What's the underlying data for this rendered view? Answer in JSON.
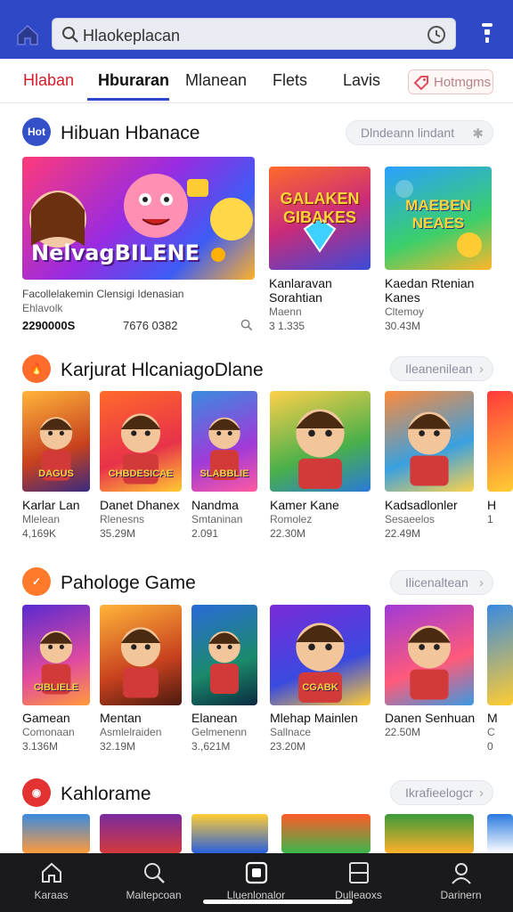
{
  "colors": {
    "brand_blue": "#2f48c8",
    "red_tab": "#d21e2a",
    "nav_bg": "#1a1a1c"
  },
  "search": {
    "text": "Hlaokeplacan",
    "left_icon": "search-icon",
    "right_icon": "clock-icon"
  },
  "tabs": [
    {
      "label": "Hlaban"
    },
    {
      "label": "Hburaran"
    },
    {
      "label": "Mlanean"
    },
    {
      "label": "Flets"
    },
    {
      "label": "Lavis"
    },
    {
      "label": "Hotmgms"
    }
  ],
  "section1": {
    "badge": "Hot",
    "title": "Hibuan Hbanace",
    "pill": "Dlndeann lindant",
    "featured": {
      "art_text": "NelvagBILENE",
      "caption": "Facollelakemin Clensigi Idenasian",
      "sub": "Ehlavolk",
      "stat1": "2290000S",
      "stat2": "7676 0382",
      "search_icon": "search-icon"
    },
    "cards": [
      {
        "art_text": "GALAKEN GIBAKES",
        "title": "Kanlaravan Sorahtian",
        "sub": "Maenn",
        "num": "3 1.335"
      },
      {
        "art_text": "MAEBEN NEAES",
        "title": "Kaedan Rtenian Kanes",
        "sub": "Cltemoy",
        "num": "30.43M"
      }
    ]
  },
  "section2": {
    "title": "Karjurat HlcaniagoDlane",
    "pill": "Ileanenilean",
    "cards": [
      {
        "art_text": "DAGUS",
        "title": "Karlar Lan",
        "sub": "Mlelean",
        "num": "4,169K"
      },
      {
        "art_text": "CHBDESICAE",
        "title": "Danet Dhanex",
        "sub": "Rlenesns",
        "num": "35.29M"
      },
      {
        "art_text": "SLABBLIE",
        "title": "Nandma",
        "sub": "Smtaninan",
        "num": "2.091"
      },
      {
        "art_text": "",
        "title": "Kamer Kane",
        "sub": "Romolez",
        "num": "22.30M"
      },
      {
        "art_text": "",
        "title": "Kadsadlonler",
        "sub": "Sesaeelos",
        "num": "22.49M"
      },
      {
        "art_text": "",
        "title": "H",
        "sub": "",
        "num": "1"
      }
    ]
  },
  "section3": {
    "title": "Pahologe Game",
    "pill": "Ilicenaltean",
    "cards": [
      {
        "art_text": "CIBLIELE",
        "title": "Gamean",
        "sub": "Comonaan",
        "num": "3.136M"
      },
      {
        "art_text": "",
        "title": "Mentan",
        "sub": "Asmlelraiden",
        "num": "32.19M"
      },
      {
        "art_text": "",
        "title": "Elanean",
        "sub": "Gelmenenn",
        "num": "3.,621M"
      },
      {
        "art_text": "CGABK",
        "title": "Mlehap Mainlen",
        "sub": "Sallnace",
        "num": "23.20M"
      },
      {
        "art_text": "",
        "title": "Danen Senhuan",
        "sub": "",
        "num": "22.50M"
      },
      {
        "art_text": "",
        "title": "M",
        "sub": "C",
        "num": "0"
      }
    ]
  },
  "section4": {
    "title": "Kahlorame",
    "pill": "Ikrafieelogcr"
  },
  "bottomnav": [
    {
      "label": "Karaas",
      "icon": "home-icon"
    },
    {
      "label": "Maitepcoan",
      "icon": "search-icon"
    },
    {
      "label": "Lluenlonalor",
      "icon": "games-icon"
    },
    {
      "label": "Dulleaoxs",
      "icon": "library-icon"
    },
    {
      "label": "Darinern",
      "icon": "profile-icon"
    }
  ]
}
